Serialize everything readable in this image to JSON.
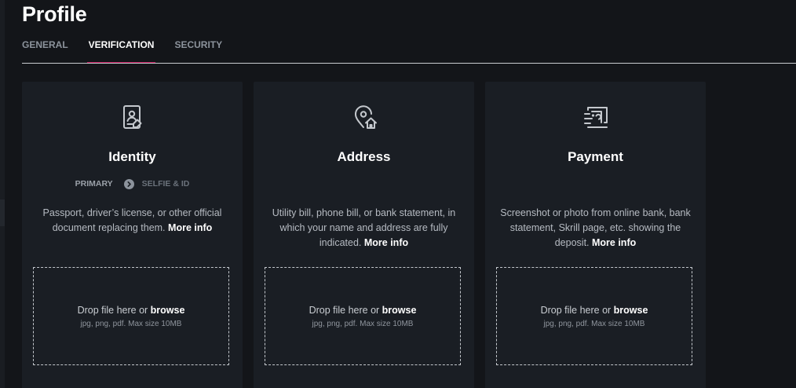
{
  "page": {
    "title": "Profile"
  },
  "tabs": [
    {
      "label": "GENERAL",
      "active": false
    },
    {
      "label": "VERIFICATION",
      "active": true
    },
    {
      "label": "SECURITY",
      "active": false
    }
  ],
  "colors": {
    "background": "#131519",
    "card": "#1a1e24",
    "accent": "#c2185b",
    "text_primary": "#ffffff",
    "text_secondary": "#b6bbc2"
  },
  "cards": [
    {
      "icon": "id-card-icon",
      "title": "Identity",
      "steps": {
        "primary": "PRIMARY",
        "secondary": "SELFIE & ID"
      },
      "description": "Passport, driver’s license, or other official document replacing them.",
      "more_info": "More info",
      "drop_text": "Drop file here or",
      "browse": "browse",
      "drop_hint": "jpg, png, pdf. Max size 10MB"
    },
    {
      "icon": "location-home-icon",
      "title": "Address",
      "description": "Utility bill, phone bill, or bank statement, in which your name and address are fully indicated.",
      "more_info": "More info",
      "drop_text": "Drop file here or",
      "browse": "browse",
      "drop_hint": "jpg, png, pdf. Max size 10MB"
    },
    {
      "icon": "payment-card-icon",
      "title": "Payment",
      "description": "Screenshot or photo from online bank, bank statement, Skrill page, etc. showing the deposit.",
      "more_info": "More info",
      "drop_text": "Drop file here or",
      "browse": "browse",
      "drop_hint": "jpg, png, pdf. Max size 10MB"
    }
  ]
}
